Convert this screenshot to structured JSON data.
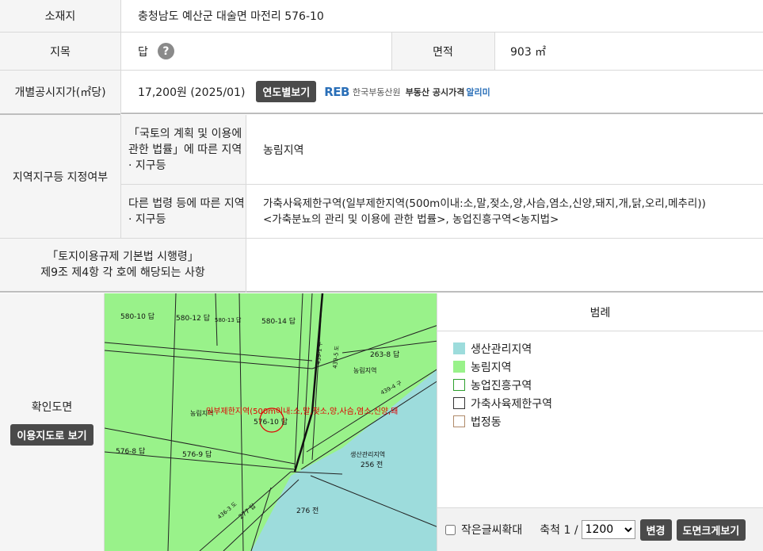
{
  "rows": {
    "location": {
      "label": "소재지",
      "value": "충청남도 예산군 대술면 마전리 576-10"
    },
    "land_category": {
      "label": "지목",
      "value": "답",
      "help_icon": "question-icon"
    },
    "area": {
      "label": "면적",
      "value": "903 ㎡"
    },
    "price": {
      "label": "개별공시지가(㎡당)",
      "value": "17,200원 (2025/01)",
      "button": "연도별보기",
      "logo_mark": "REB",
      "logo_name": "한국부동산원",
      "logo_service": "부동산 공시가격",
      "logo_alimi": "알리미"
    },
    "zoning": {
      "label": "지역지구등 지정여부",
      "sub1_label": "「국토의 계획 및 이용에 관한 법률」에 따른 지역 · 지구등",
      "sub1_value": "농림지역",
      "sub2_label": "다른 법령 등에 따른 지역 · 지구등",
      "sub2_value_line1": "가축사육제한구역(일부제한지역(500m이내:소,말,젖소,양,사슴,염소,신양,돼지,개,닭,오리,메추리))",
      "sub2_value_line2": "<가축분뇨의 관리 및 이용에 관한 법률>, 농업진흥구역<농지법>"
    },
    "enforcement": {
      "label_line1": "「토지이용규제 기본법 시행령」",
      "label_line2": "제9조 제4항 각 호에 해당되는 사항",
      "value": ""
    },
    "map": {
      "label": "확인도면",
      "button": "이용지도로 보기"
    }
  },
  "map_labels": {
    "p580_10": "580-10 답",
    "p580_12": "580-12 답",
    "p580_13": "580-13 답",
    "p580_14": "580-14 답",
    "p263_8": "263-8 답",
    "p576_10": "576-10 답",
    "p576_8": "576-8 답",
    "p576_9": "576-9 답",
    "p256": "256 전",
    "p276": "276 전",
    "zone_nongrim1": "농림지역",
    "zone_nongrim2": "농림지역",
    "zone_saengsan": "생산관리지역",
    "road1": "439-1 구",
    "road2": "439-4 구",
    "road3": "439-5 도",
    "road4": "277 답",
    "road5": "436-3 도",
    "overlay_text": "일부제한지역(500m이내:소,말,젖소,양,사슴,염소,신양,돼"
  },
  "legend": {
    "title": "범례",
    "items": [
      {
        "label": "생산관리지역",
        "fill": "#9ddcdc",
        "border": "#9ddcdc"
      },
      {
        "label": "농림지역",
        "fill": "#99f28a",
        "border": "#99f28a"
      },
      {
        "label": "농업진흥구역",
        "fill": "#ffffff",
        "border": "#2ea02e"
      },
      {
        "label": "가축사육제한구역",
        "fill": "#ffffff",
        "border": "#333333"
      },
      {
        "label": "법정동",
        "fill": "#ffffff",
        "border": "#b08a6a"
      }
    ]
  },
  "controls": {
    "small_text_zoom_label": "작은글씨확대",
    "scale_label": "축척 1 /",
    "scale_value": "1200",
    "change_button": "변경",
    "enlarge_button": "도면크게보기"
  },
  "colors": {
    "green_zone": "#99f28a",
    "cyan_zone": "#9ddcdc",
    "dark_button": "#4a4a4a",
    "overlay_red": "#e00000"
  }
}
